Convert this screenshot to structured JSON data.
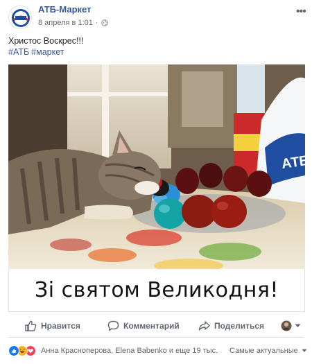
{
  "post": {
    "page_name": "АТБ-Маркет",
    "timestamp": "8 апреля в 1:01",
    "privacy_icon": "globe-icon",
    "text": "Христос Воскрес!!!",
    "hashtags": [
      "#АТБ",
      "#маркет"
    ],
    "image_caption": "Зі святом Великодня!",
    "image_bag_logo": "АТБ"
  },
  "actions": {
    "like_label": "Нравится",
    "comment_label": "Комментарий",
    "share_label": "Поделиться"
  },
  "reactions": {
    "names_text": "Анна Красноперова, Elena Babenko и еще 19 тыс.",
    "sort_label": "Самые актуальные",
    "icons": [
      "like-reaction",
      "haha-reaction",
      "love-reaction"
    ]
  },
  "colors": {
    "link_blue": "#385898",
    "text_gray": "#606770",
    "like_blue": "#1877f2",
    "love_red": "#f33e58",
    "haha_yellow": "#f7b125"
  }
}
